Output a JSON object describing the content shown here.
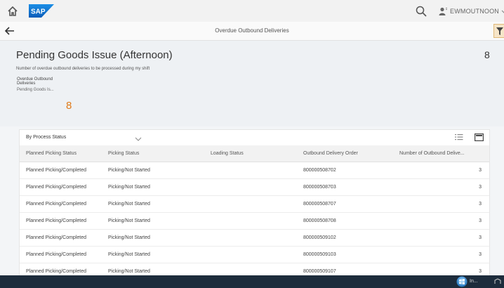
{
  "shell": {
    "logo_text": "SAP",
    "user_name": "EWMOUTNOON"
  },
  "subheader": {
    "title": "Overdue Outbound Deliveries"
  },
  "kpi": {
    "title": "Pending Goods Issue (Afternoon)",
    "right_value": "8",
    "description": "Number of overdue outbound deliveries to be processed during my shift",
    "card_label": "Overdue Outbound Deliveries",
    "card_sub": "Pending Goods Is...",
    "card_value": "8"
  },
  "table": {
    "view_select": "By Process Status",
    "columns": [
      "Planned Picking Status",
      "Picking Status",
      "Loading Status",
      "Outbound Delivery Order",
      "Number of Outbound Delive..."
    ],
    "rows": [
      {
        "planned": "Planned Picking/Completed",
        "picking": "Picking/Not Started",
        "loading": "",
        "order": "800000508702",
        "count": "3"
      },
      {
        "planned": "Planned Picking/Completed",
        "picking": "Picking/Not Started",
        "loading": "",
        "order": "800000508703",
        "count": "3"
      },
      {
        "planned": "Planned Picking/Completed",
        "picking": "Picking/Not Started",
        "loading": "",
        "order": "800000508707",
        "count": "3"
      },
      {
        "planned": "Planned Picking/Completed",
        "picking": "Picking/Not Started",
        "loading": "",
        "order": "800000508708",
        "count": "3"
      },
      {
        "planned": "Planned Picking/Completed",
        "picking": "Picking/Not Started",
        "loading": "",
        "order": "800000509102",
        "count": "3"
      },
      {
        "planned": "Planned Picking/Completed",
        "picking": "Picking/Not Started",
        "loading": "",
        "order": "800000509103",
        "count": "3"
      },
      {
        "planned": "Planned Picking/Completed",
        "picking": "Picking/Not Started",
        "loading": "",
        "order": "800000509107",
        "count": "3"
      }
    ]
  },
  "taskbar": {
    "tray_text": "In..."
  },
  "colors": {
    "accent_orange": "#e07a19",
    "sap_blue": "#0a6ed1",
    "taskbar": "#1d2c3c"
  },
  "icons": [
    "home-icon",
    "sap-logo",
    "search-icon",
    "user-icon",
    "chevron-down-icon",
    "back-icon",
    "filter-icon",
    "list-view-icon",
    "fullscreen-icon",
    "start-orb-icon"
  ]
}
